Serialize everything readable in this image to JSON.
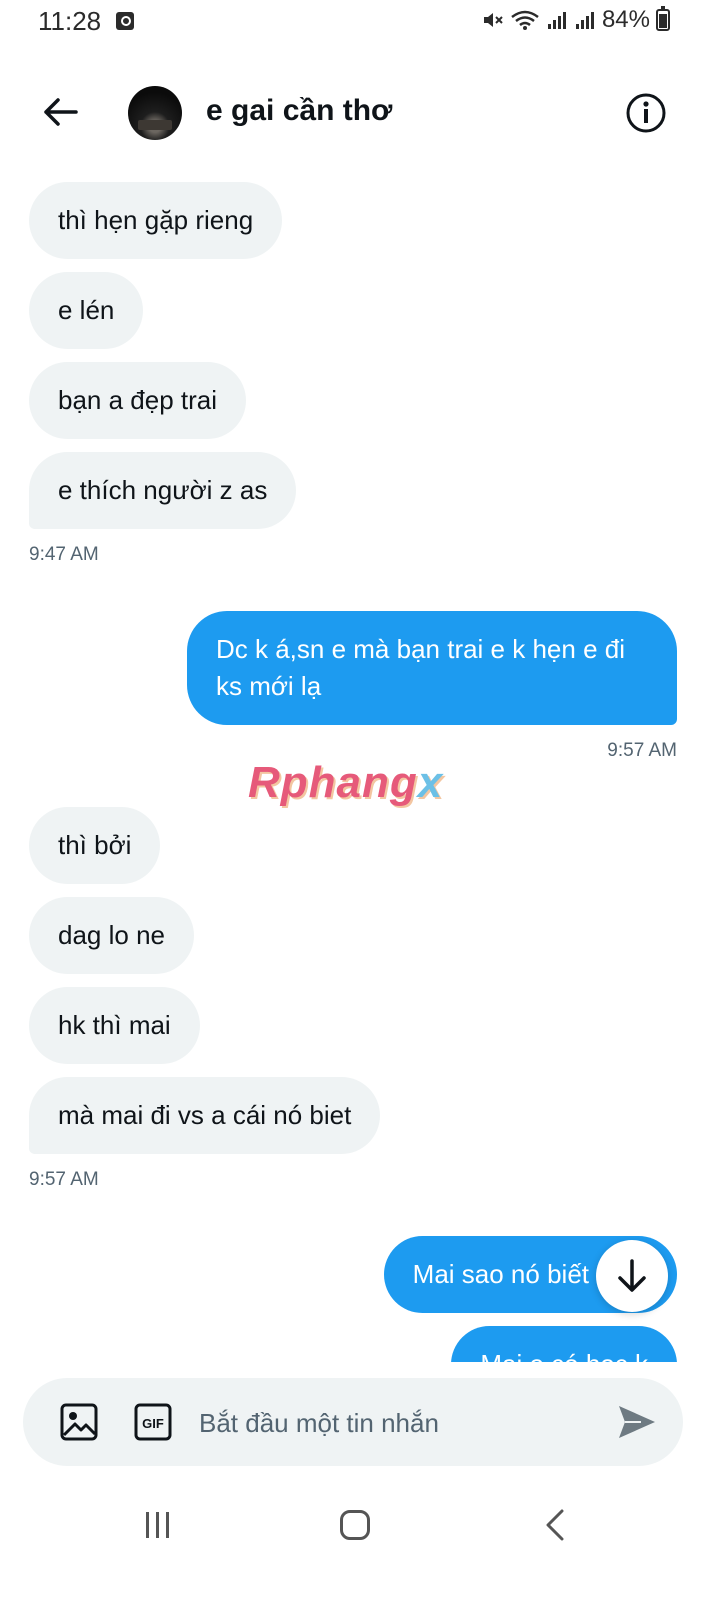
{
  "status_bar": {
    "time": "11:28",
    "battery": "84%",
    "icons": [
      "alarm-icon",
      "mute-icon",
      "wifi-icon",
      "signal-icon",
      "signal-icon",
      "battery-icon"
    ]
  },
  "header": {
    "contact_name": "e gai cần thơ",
    "icons": [
      "back-arrow-icon",
      "avatar",
      "info-icon"
    ]
  },
  "messages": [
    {
      "dir": "in",
      "text": "thì hẹn gặp rieng"
    },
    {
      "dir": "in",
      "text": "e lén"
    },
    {
      "dir": "in",
      "text": "bạn a đẹp trai"
    },
    {
      "dir": "in",
      "text": "e thích người z as"
    },
    {
      "dir": "in",
      "time": "9:47 AM"
    },
    {
      "dir": "out",
      "text": "Dc k á,sn e mà bạn trai e k hẹn e đi ks mới lạ"
    },
    {
      "dir": "out",
      "time": "9:57 AM"
    },
    {
      "dir": "in",
      "text": "thì bởi"
    },
    {
      "dir": "in",
      "text": "dag lo ne"
    },
    {
      "dir": "in",
      "text": "hk thì mai"
    },
    {
      "dir": "in",
      "text": "mà mai đi vs a cái nó biet"
    },
    {
      "dir": "in",
      "time": "9:57 AM"
    },
    {
      "dir": "out",
      "text": "Mai sao nó biết"
    },
    {
      "dir": "out",
      "text": "Mai e có học k"
    }
  ],
  "watermark": {
    "part1": "Rphang",
    "part2": "x"
  },
  "composer": {
    "placeholder": "Bắt đầu một tin nhắn",
    "icons": [
      "image-icon",
      "gif-icon",
      "send-icon"
    ]
  },
  "nav_bar": {
    "icons": [
      "recent-apps-icon",
      "home-icon",
      "back-icon"
    ]
  },
  "colors": {
    "accent": "#1d9bf0",
    "incoming_bubble": "#eff3f4",
    "text": "#0f1419",
    "secondary_text": "#536471"
  }
}
